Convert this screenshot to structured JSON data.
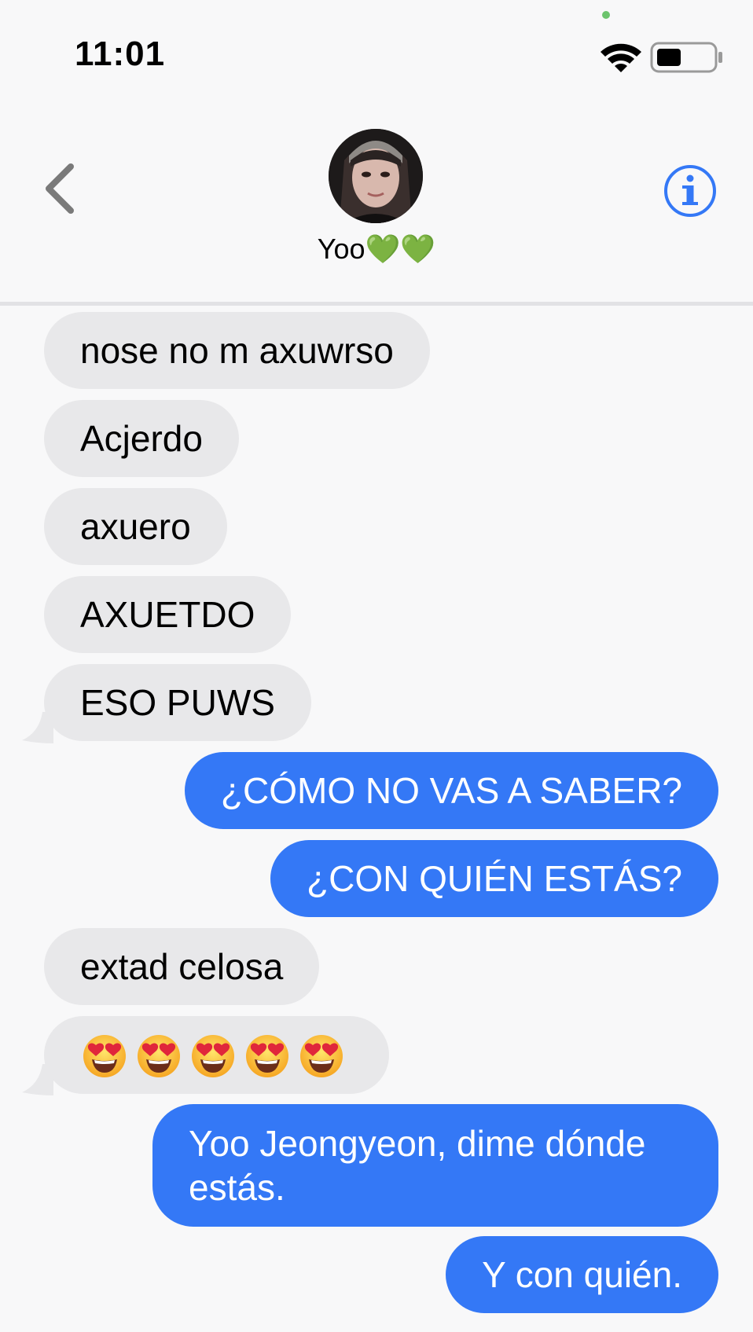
{
  "status": {
    "time": "11:01"
  },
  "header": {
    "contact_name": "Yoo💚💚",
    "back_icon": "chevron-left-icon",
    "info_icon": "info-circle-icon"
  },
  "colors": {
    "outgoing_bubble": "#3478f6",
    "incoming_bubble": "#e8e8ea",
    "accent": "#3478f6"
  },
  "messages": [
    {
      "direction": "incoming",
      "text": "nose no m axuwrso"
    },
    {
      "direction": "incoming",
      "text": "Acjerdo"
    },
    {
      "direction": "incoming",
      "text": "axuero"
    },
    {
      "direction": "incoming",
      "text": "AXUETDO"
    },
    {
      "direction": "incoming",
      "text": "ESO PUWS"
    },
    {
      "direction": "outgoing",
      "text": "¿CÓMO NO VAS A SABER?"
    },
    {
      "direction": "outgoing",
      "text": "¿CON QUIÉN ESTÁS?"
    },
    {
      "direction": "incoming",
      "text": "extad celosa"
    },
    {
      "direction": "incoming",
      "text": "😍😍😍😍😍",
      "emoji": "smiling-face-with-heart-eyes",
      "emoji_count": 5
    },
    {
      "direction": "outgoing",
      "text": "Yoo Jeongyeon, dime dónde estás."
    },
    {
      "direction": "outgoing",
      "text": "Y con quién."
    }
  ]
}
